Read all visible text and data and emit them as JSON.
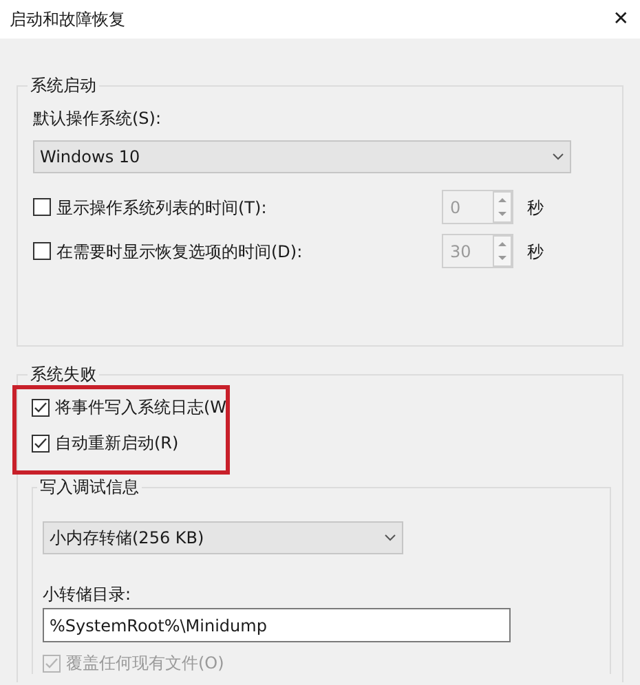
{
  "window": {
    "title": "启动和故障恢复",
    "close": "✕"
  },
  "startup": {
    "title": "系统启动",
    "os_label": "默认操作系统(S):",
    "os_value": "Windows 10",
    "rows": [
      {
        "label": "显示操作系统列表的时间(T):",
        "checked": false,
        "value": "0",
        "unit": "秒",
        "disabled": true
      },
      {
        "label": "在需要时显示恢复选项的时间(D):",
        "checked": false,
        "value": "30",
        "unit": "秒",
        "disabled": true
      }
    ]
  },
  "failure": {
    "title": "系统失败",
    "highlighted": true,
    "options": [
      {
        "label": "将事件写入系统日志(W",
        "checked": true
      },
      {
        "label": "自动重新启动(R)",
        "checked": true
      }
    ],
    "debug": {
      "title": "写入调试信息",
      "dump_value": "小内存转储(256 KB)",
      "dir_label": "小转储目录:",
      "dir_value": "%SystemRoot%\\Minidump",
      "overwrite": {
        "label": "覆盖任何现有文件(O)",
        "checked": true,
        "disabled": true
      }
    }
  }
}
